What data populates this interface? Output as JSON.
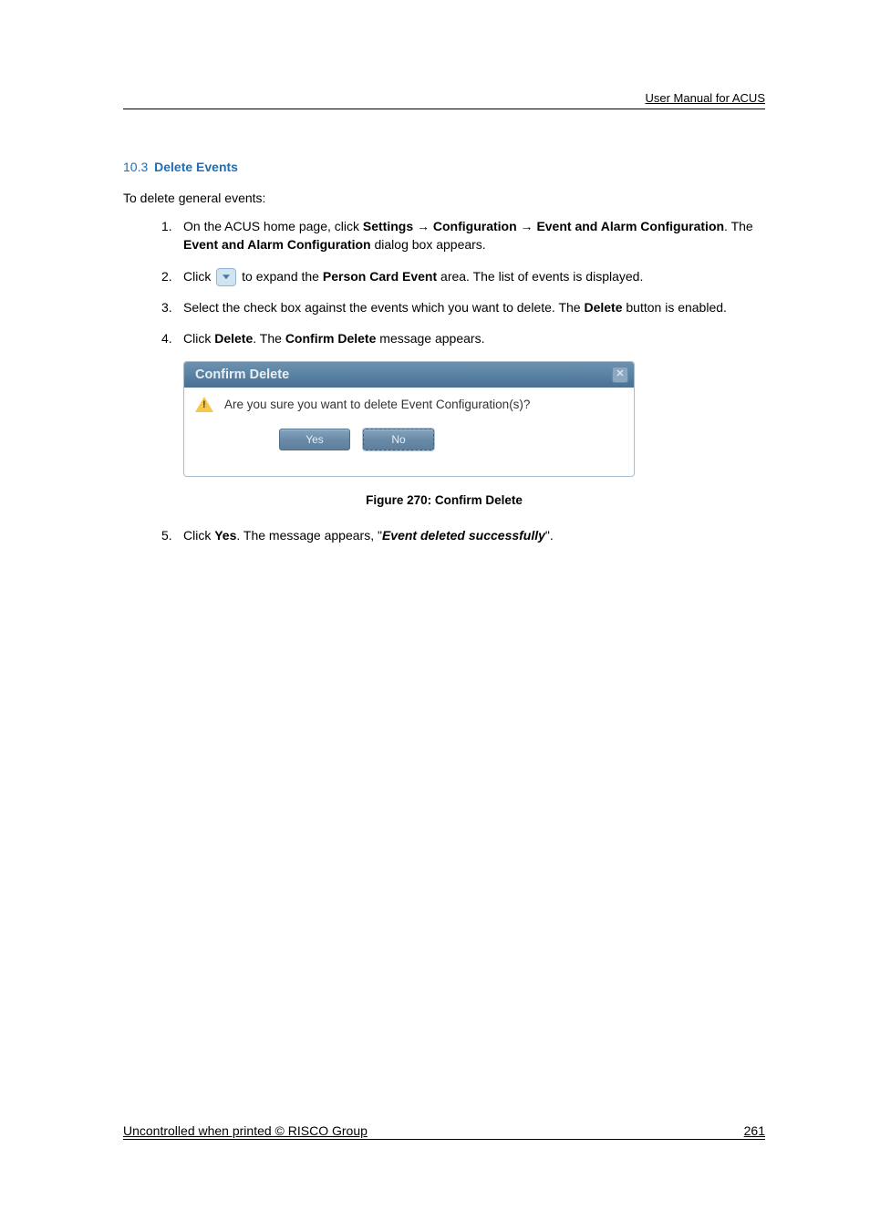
{
  "header": {
    "right": "User Manual for ACUS"
  },
  "section": {
    "number": "10.3",
    "title": "Delete Events"
  },
  "intro": "To delete general events:",
  "steps": {
    "s1": {
      "num": "1.",
      "t1": "On the ACUS home page, click ",
      "b1": "Settings",
      "arrow1": " → ",
      "b2": "Configuration",
      "arrow2": " → ",
      "b3": "Event and Alarm Configuration",
      "t2": ". The ",
      "b4": "Event and Alarm Configuration",
      "t3": " dialog box appears."
    },
    "s2": {
      "num": "2.",
      "t1": "Click ",
      "t2": " to expand the ",
      "b1": "Person Card Event",
      "t3": " area. The list of events is displayed."
    },
    "s3": {
      "num": "3.",
      "t1": "Select the check box against the events which you want to delete. The ",
      "b1": "Delete",
      "t2": " button is enabled."
    },
    "s4": {
      "num": "4.",
      "t1": "Click ",
      "b1": "Delete",
      "t2": ". The ",
      "b2": "Confirm Delete",
      "t3": " message appears."
    },
    "s5": {
      "num": "5.",
      "t1": "Click ",
      "b1": "Yes",
      "t2": ". The message appears, \"",
      "bi1": "Event deleted successfully",
      "t3": "\"."
    }
  },
  "dialog": {
    "title": "Confirm Delete",
    "message": "Are you sure you want to delete Event Configuration(s)?",
    "yes": "Yes",
    "no": "No"
  },
  "figure": "Figure 270: Confirm Delete",
  "footer": {
    "left": "Uncontrolled when printed © RISCO Group",
    "right": "261"
  }
}
